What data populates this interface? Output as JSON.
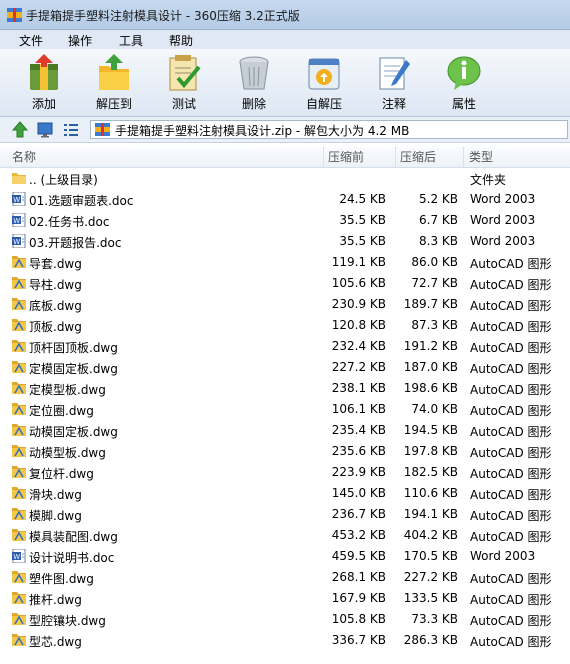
{
  "window": {
    "title": "手提箱提手塑料注射模具设计 - 360压缩 3.2正式版"
  },
  "menu": [
    "文件",
    "操作",
    "工具",
    "帮助"
  ],
  "toolbar": [
    {
      "label": "添加",
      "icon": "add-icon"
    },
    {
      "label": "解压到",
      "icon": "extract-icon"
    },
    {
      "label": "测试",
      "icon": "test-icon"
    },
    {
      "label": "删除",
      "icon": "delete-icon"
    },
    {
      "label": "自解压",
      "icon": "self-extract-icon"
    },
    {
      "label": "注释",
      "icon": "comment-icon"
    },
    {
      "label": "属性",
      "icon": "info-icon"
    }
  ],
  "address": {
    "path": "手提箱提手塑料注射模具设计.zip - 解包大小为 4.2 MB"
  },
  "columns": {
    "name": "名称",
    "original": "压缩前",
    "compressed": "压缩后",
    "type": "类型"
  },
  "files": [
    {
      "name": ".. (上级目录)",
      "original": "",
      "compressed": "",
      "type": "文件夹",
      "icon": "folder-icon"
    },
    {
      "name": "01.选题审题表.doc",
      "original": "24.5 KB",
      "compressed": "5.2 KB",
      "type": "Word 2003",
      "icon": "word-doc-icon"
    },
    {
      "name": "02.任务书.doc",
      "original": "35.5 KB",
      "compressed": "6.7 KB",
      "type": "Word 2003",
      "icon": "word-doc-icon"
    },
    {
      "name": "03.开题报告.doc",
      "original": "35.5 KB",
      "compressed": "8.3 KB",
      "type": "Word 2003",
      "icon": "word-doc-icon"
    },
    {
      "name": "导套.dwg",
      "original": "119.1 KB",
      "compressed": "86.0 KB",
      "type": "AutoCAD 图形",
      "icon": "dwg-icon"
    },
    {
      "name": "导柱.dwg",
      "original": "105.6 KB",
      "compressed": "72.7 KB",
      "type": "AutoCAD 图形",
      "icon": "dwg-icon"
    },
    {
      "name": "底板.dwg",
      "original": "230.9 KB",
      "compressed": "189.7 KB",
      "type": "AutoCAD 图形",
      "icon": "dwg-icon"
    },
    {
      "name": "顶板.dwg",
      "original": "120.8 KB",
      "compressed": "87.3 KB",
      "type": "AutoCAD 图形",
      "icon": "dwg-icon"
    },
    {
      "name": "顶杆固顶板.dwg",
      "original": "232.4 KB",
      "compressed": "191.2 KB",
      "type": "AutoCAD 图形",
      "icon": "dwg-icon"
    },
    {
      "name": "定模固定板.dwg",
      "original": "227.2 KB",
      "compressed": "187.0 KB",
      "type": "AutoCAD 图形",
      "icon": "dwg-icon"
    },
    {
      "name": "定模型板.dwg",
      "original": "238.1 KB",
      "compressed": "198.6 KB",
      "type": "AutoCAD 图形",
      "icon": "dwg-icon"
    },
    {
      "name": "定位圈.dwg",
      "original": "106.1 KB",
      "compressed": "74.0 KB",
      "type": "AutoCAD 图形",
      "icon": "dwg-icon"
    },
    {
      "name": "动模固定板.dwg",
      "original": "235.4 KB",
      "compressed": "194.5 KB",
      "type": "AutoCAD 图形",
      "icon": "dwg-icon"
    },
    {
      "name": "动模型板.dwg",
      "original": "235.6 KB",
      "compressed": "197.8 KB",
      "type": "AutoCAD 图形",
      "icon": "dwg-icon"
    },
    {
      "name": "复位杆.dwg",
      "original": "223.9 KB",
      "compressed": "182.5 KB",
      "type": "AutoCAD 图形",
      "icon": "dwg-icon"
    },
    {
      "name": "滑块.dwg",
      "original": "145.0 KB",
      "compressed": "110.6 KB",
      "type": "AutoCAD 图形",
      "icon": "dwg-icon"
    },
    {
      "name": "模脚.dwg",
      "original": "236.7 KB",
      "compressed": "194.1 KB",
      "type": "AutoCAD 图形",
      "icon": "dwg-icon"
    },
    {
      "name": "模具装配图.dwg",
      "original": "453.2 KB",
      "compressed": "404.2 KB",
      "type": "AutoCAD 图形",
      "icon": "dwg-icon"
    },
    {
      "name": "设计说明书.doc",
      "original": "459.5 KB",
      "compressed": "170.5 KB",
      "type": "Word 2003",
      "icon": "word-doc-icon"
    },
    {
      "name": "塑件图.dwg",
      "original": "268.1 KB",
      "compressed": "227.2 KB",
      "type": "AutoCAD 图形",
      "icon": "dwg-icon"
    },
    {
      "name": "推杆.dwg",
      "original": "167.9 KB",
      "compressed": "133.5 KB",
      "type": "AutoCAD 图形",
      "icon": "dwg-icon"
    },
    {
      "name": "型腔镶块.dwg",
      "original": "105.8 KB",
      "compressed": "73.3 KB",
      "type": "AutoCAD 图形",
      "icon": "dwg-icon"
    },
    {
      "name": "型芯.dwg",
      "original": "336.7 KB",
      "compressed": "286.3 KB",
      "type": "AutoCAD 图形",
      "icon": "dwg-icon"
    }
  ]
}
